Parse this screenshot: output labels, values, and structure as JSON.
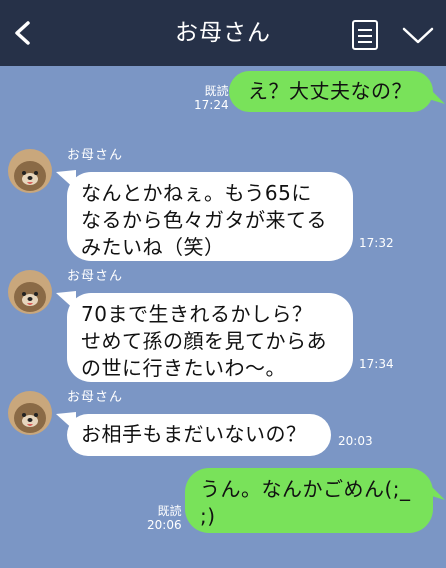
{
  "header": {
    "title": "お母さん"
  },
  "messages": [
    {
      "side": "right",
      "text": "え？大丈夫なの？",
      "read": "既読",
      "time": "17:24"
    },
    {
      "side": "left",
      "sender": "お母さん",
      "text": "なんとかねぇ。もう65に\nなるから色々ガタが来てる\nみたいね（笑）",
      "time": "17:32"
    },
    {
      "side": "left",
      "sender": "お母さん",
      "text": "70まで生きれるかしら？\nせめて孫の顔を見てからあ\nの世に行きたいわ〜。",
      "time": "17:34"
    },
    {
      "side": "left",
      "sender": "お母さん",
      "text": "お相手もまだいないの？",
      "time": "20:03"
    },
    {
      "side": "right",
      "text": "うん。なんかごめん(;_\n;)",
      "read": "既読",
      "time": "20:06"
    }
  ],
  "colors": {
    "header_bg": "#263148",
    "chat_bg": "#7b96c5",
    "incoming_bubble": "#ffffff",
    "outgoing_bubble": "#79e25a"
  },
  "icons": {
    "back": "chevron-left-icon",
    "notes": "notes-icon",
    "menu": "chevron-down-icon",
    "avatar": "dog-avatar"
  }
}
